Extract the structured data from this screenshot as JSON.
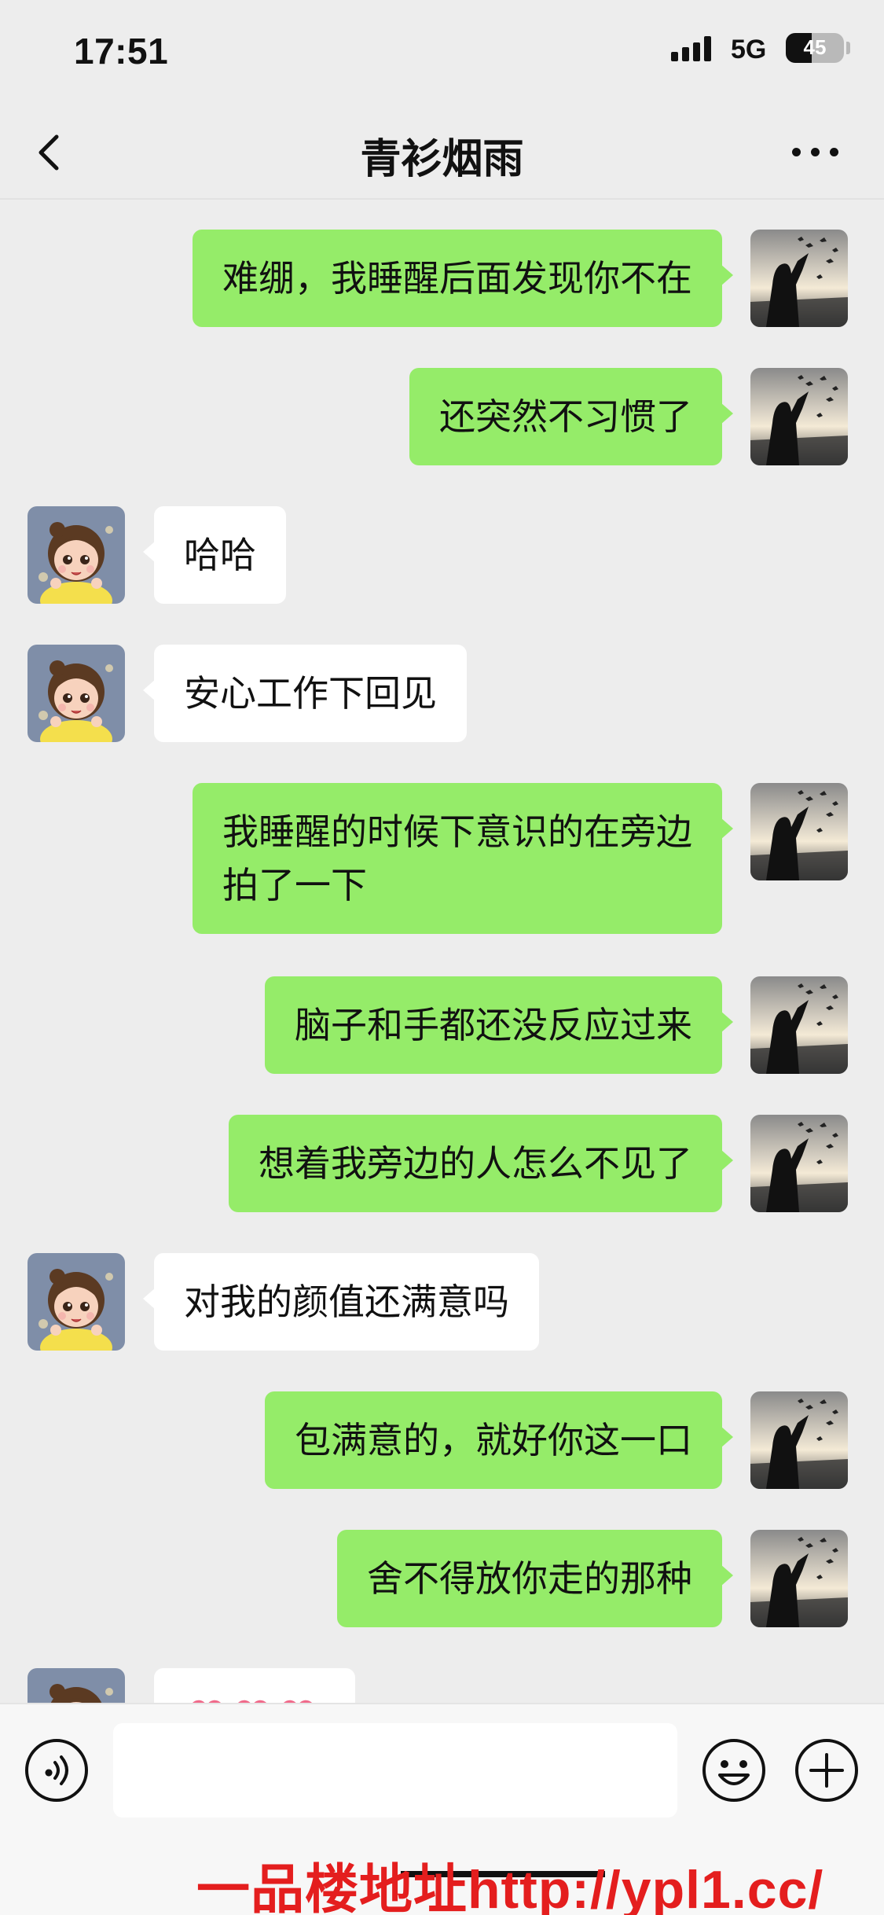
{
  "status": {
    "time": "17:51",
    "network": "5G",
    "battery": "45",
    "battery_level": 0.45
  },
  "header": {
    "title": "青衫烟雨"
  },
  "messages": [
    {
      "side": "out",
      "text": "难绷，我睡醒后面发现你不在"
    },
    {
      "side": "out",
      "text": "还突然不习惯了"
    },
    {
      "side": "in",
      "text": "哈哈"
    },
    {
      "side": "in",
      "text": "安心工作下回见"
    },
    {
      "side": "out",
      "text": "我睡醒的时候下意识的在旁边\n拍了一下"
    },
    {
      "side": "out",
      "text": "脑子和手都还没反应过来"
    },
    {
      "side": "out",
      "text": "想着我旁边的人怎么不见了"
    },
    {
      "side": "in",
      "text": "对我的颜值还满意吗"
    },
    {
      "side": "out",
      "text": "包满意的，就好你这一口"
    },
    {
      "side": "out",
      "text": "舍不得放你走的那种"
    },
    {
      "side": "in",
      "emoji": "heart-emoji",
      "count": 3
    }
  ],
  "composer": {
    "value": ""
  },
  "watermark": {
    "text": "一品楼地址http://ypl1.cc/"
  },
  "colors": {
    "outgoing_bubble": "#95ec69",
    "incoming_bubble": "#ffffff",
    "background": "#ededed",
    "heart": "#f06a8a"
  },
  "icons": [
    "back-arrow-icon",
    "more-icon",
    "voice-icon",
    "emoji-icon",
    "plus-icon"
  ]
}
